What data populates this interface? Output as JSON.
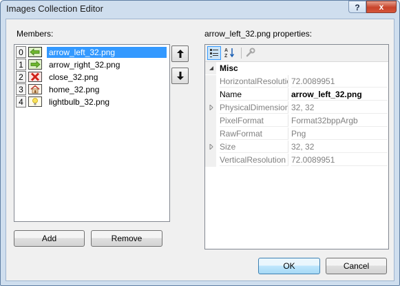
{
  "window": {
    "title": "Images Collection Editor",
    "help_glyph": "?",
    "close_glyph": "x"
  },
  "members": {
    "label": "Members:",
    "items": [
      {
        "index": "0",
        "name": "arrow_left_32.png",
        "icon": "arrow-left-icon",
        "selected": true
      },
      {
        "index": "1",
        "name": "arrow_right_32.png",
        "icon": "arrow-right-icon",
        "selected": false
      },
      {
        "index": "2",
        "name": "close_32.png",
        "icon": "close-x-icon",
        "selected": false
      },
      {
        "index": "3",
        "name": "home_32.png",
        "icon": "home-icon",
        "selected": false
      },
      {
        "index": "4",
        "name": "lightbulb_32.png",
        "icon": "lightbulb-icon",
        "selected": false
      }
    ],
    "add_label": "Add",
    "remove_label": "Remove"
  },
  "properties": {
    "label": "arrow_left_32.png properties:",
    "category": "Misc",
    "rows": [
      {
        "name": "HorizontalResolution",
        "value": "72.0089951",
        "editable": false,
        "expandable": false
      },
      {
        "name": "Name",
        "value": "arrow_left_32.png",
        "editable": true,
        "expandable": false
      },
      {
        "name": "PhysicalDimension",
        "value": "32, 32",
        "editable": false,
        "expandable": true
      },
      {
        "name": "PixelFormat",
        "value": "Format32bppArgb",
        "editable": false,
        "expandable": false
      },
      {
        "name": "RawFormat",
        "value": "Png",
        "editable": false,
        "expandable": false
      },
      {
        "name": "Size",
        "value": "32, 32",
        "editable": false,
        "expandable": true
      },
      {
        "name": "VerticalResolution",
        "value": "72.0089951",
        "editable": false,
        "expandable": false
      }
    ]
  },
  "footer": {
    "ok_label": "OK",
    "cancel_label": "Cancel"
  },
  "colors": {
    "selection": "#3399ff",
    "window_frame": "#cfdeee",
    "close_button": "#c8442b"
  }
}
